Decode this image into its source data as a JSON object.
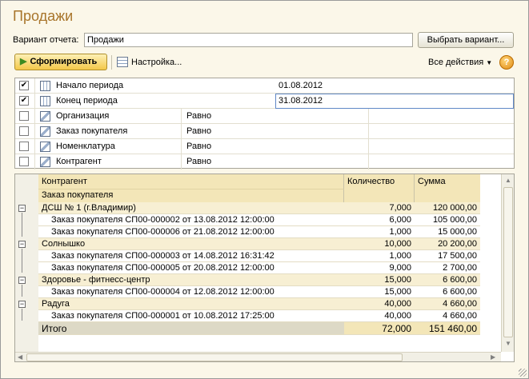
{
  "window": {
    "title": "Продажи"
  },
  "header": {
    "variant_label": "Вариант отчета:",
    "variant_value": "Продажи",
    "choose_variant_button": "Выбрать вариант..."
  },
  "toolbar": {
    "generate_button": "Сформировать",
    "settings_button": "Настройка...",
    "all_actions": "Все действия",
    "help_label": "?"
  },
  "filters": [
    {
      "checked": true,
      "check_mark": "✔",
      "name": "Начало периода",
      "condition": "",
      "value": "01.08.2012"
    },
    {
      "checked": true,
      "check_mark": "✔",
      "name": "Конец периода",
      "condition": "",
      "value": "31.08.2012"
    },
    {
      "checked": false,
      "check_mark": "",
      "name": "Организация",
      "condition": "Равно",
      "value": ""
    },
    {
      "checked": false,
      "check_mark": "",
      "name": "Заказ покупателя",
      "condition": "Равно",
      "value": ""
    },
    {
      "checked": false,
      "check_mark": "",
      "name": "Номенклатура",
      "condition": "Равно",
      "value": ""
    },
    {
      "checked": false,
      "check_mark": "",
      "name": "Контрагент",
      "condition": "Равно",
      "value": ""
    }
  ],
  "report": {
    "headers": {
      "counterparty": "Контрагент",
      "order": "Заказ покупателя",
      "quantity": "Количество",
      "amount": "Сумма"
    },
    "groups": [
      {
        "name": "ДСШ № 1 (г.Владимир)",
        "quantity": "7,000",
        "amount": "120 000,00",
        "orders": [
          {
            "name": "Заказ покупателя СП00-000002 от 13.08.2012 12:00:00",
            "quantity": "6,000",
            "amount": "105 000,00"
          },
          {
            "name": "Заказ покупателя СП00-000006 от 21.08.2012 12:00:00",
            "quantity": "1,000",
            "amount": "15 000,00"
          }
        ]
      },
      {
        "name": "Солнышко",
        "quantity": "10,000",
        "amount": "20 200,00",
        "orders": [
          {
            "name": "Заказ покупателя СП00-000003 от 14.08.2012 16:31:42",
            "quantity": "1,000",
            "amount": "17 500,00"
          },
          {
            "name": "Заказ покупателя СП00-000005 от 20.08.2012 12:00:00",
            "quantity": "9,000",
            "amount": "2 700,00"
          }
        ]
      },
      {
        "name": "Здоровье - фитнесс-центр",
        "quantity": "15,000",
        "amount": "6 600,00",
        "orders": [
          {
            "name": "Заказ покупателя СП00-000004 от 12.08.2012 12:00:00",
            "quantity": "15,000",
            "amount": "6 600,00"
          }
        ]
      },
      {
        "name": "Радуга",
        "quantity": "40,000",
        "amount": "4 660,00",
        "orders": [
          {
            "name": "Заказ покупателя СП00-000001 от 10.08.2012 17:25:00",
            "quantity": "40,000",
            "amount": "4 660,00"
          }
        ]
      }
    ],
    "total": {
      "label": "Итого",
      "quantity": "72,000",
      "amount": "151 460,00"
    }
  },
  "colors": {
    "title": "#a8752b",
    "header_bg": "#f3e6b8",
    "group_bg": "#f7efd3",
    "total_bg": "#ddd9c6",
    "primary_button": "#f4c84a"
  },
  "icons": {
    "generate": "play-icon",
    "settings": "settings-icon",
    "help": "help-icon",
    "period": "calendar-icon",
    "filter": "filter-icon"
  }
}
